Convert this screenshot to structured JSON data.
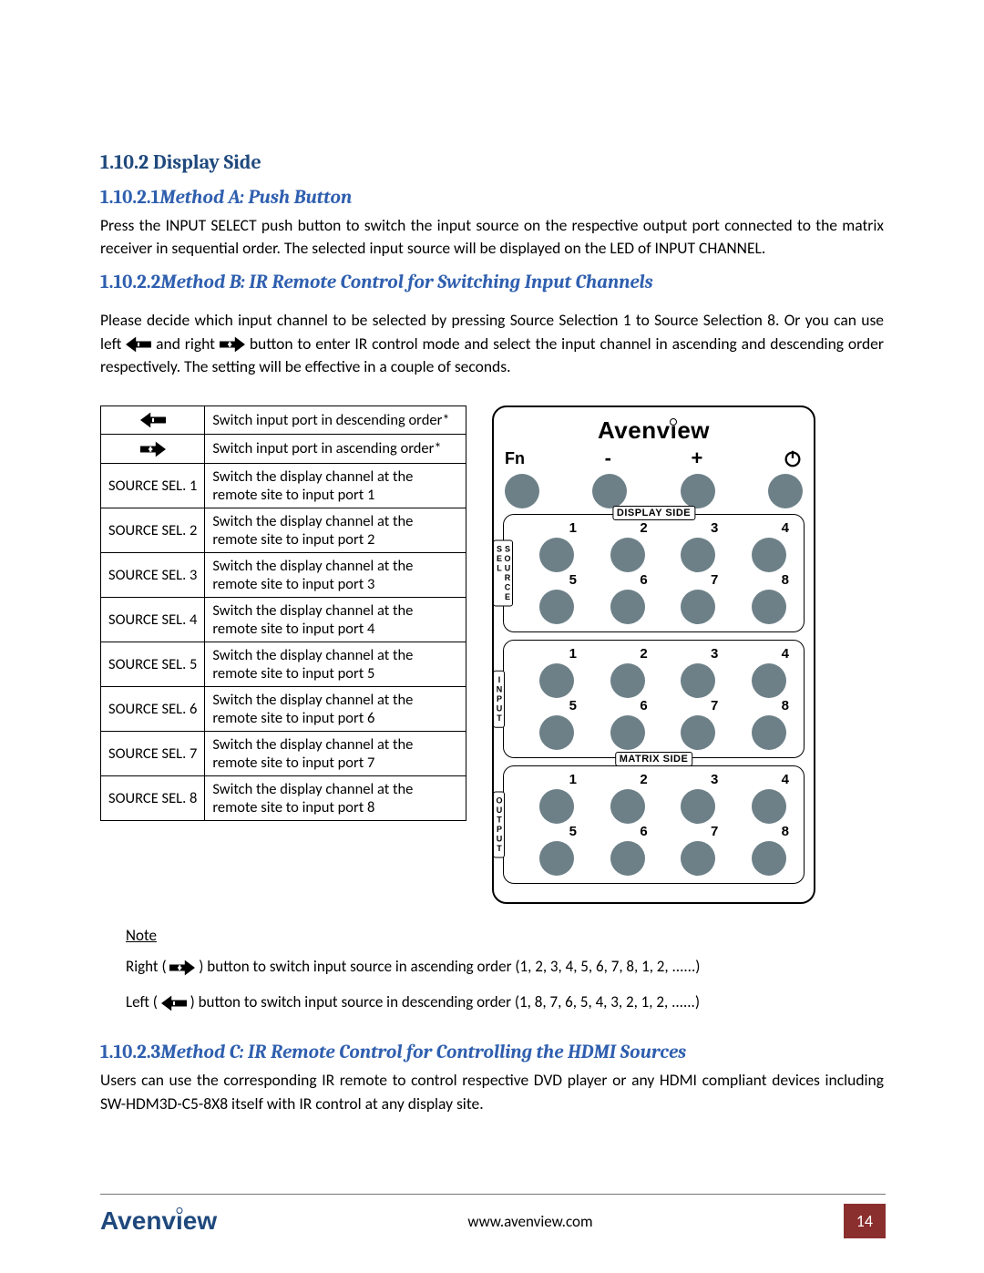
{
  "headings": {
    "h1": "1.10.2 Display Side",
    "h2a_num": "1.10.2.1",
    "h2a_txt": "Method A: Push Button",
    "h2b_num": "1.10.2.2",
    "h2b_txt": "Method B: IR Remote Control for Switching Input Channels",
    "h2c_num": "1.10.2.3",
    "h2c_txt": "Method C: IR Remote Control for Controlling the HDMI Sources"
  },
  "paragraphs": {
    "a": "Press the INPUT SELECT push button to switch the input source on the respective output port connected to the matrix receiver in sequential order. The selected input source will be displayed on the LED of INPUT CHANNEL.",
    "b_pre": "Please decide which input channel to be selected by pressing Source Selection 1 to Source Selection 8. Or you can use left ",
    "b_mid": " and right ",
    "b_post": " button to enter IR control mode and select the input channel in ascending and descending order respectively. The setting will be effective in a couple of seconds.",
    "c": "Users can use the corresponding IR remote to control respective DVD player or any HDMI compliant devices including SW-HDM3D-C5-8X8 itself with IR control at any display site."
  },
  "func_table": {
    "rows": [
      {
        "label": "__ARROW_LEFT__",
        "desc": "Switch input port in descending order*"
      },
      {
        "label": "__ARROW_RIGHT__",
        "desc": "Switch input port in ascending order*"
      },
      {
        "label": "SOURCE SEL. 1",
        "desc": "Switch the display channel at the remote site to input port 1"
      },
      {
        "label": "SOURCE SEL. 2",
        "desc": "Switch the display channel at the remote site to input port 2"
      },
      {
        "label": "SOURCE SEL. 3",
        "desc": "Switch the display channel at the remote site to input port 3"
      },
      {
        "label": "SOURCE SEL. 4",
        "desc": "Switch the display channel at the remote site to input port 4"
      },
      {
        "label": "SOURCE SEL. 5",
        "desc": "Switch the display channel at the remote site to input port 5"
      },
      {
        "label": "SOURCE SEL. 6",
        "desc": "Switch the display channel at the remote site to input port 6"
      },
      {
        "label": "SOURCE SEL. 7",
        "desc": "Switch the display channel at the remote site to input port 7"
      },
      {
        "label": "SOURCE SEL. 8",
        "desc": "Switch the display channel at the remote site to input port 8"
      }
    ]
  },
  "remote": {
    "brand": "Avenview",
    "fn": "Fn",
    "minus": "-",
    "plus": "+",
    "tags": {
      "display_side": "DISPLAY SIDE",
      "source_sel": "SOURCE SEL",
      "input": "INPUT",
      "matrix_side": "MATRIX SIDE",
      "output": "OUTPUT"
    },
    "nums_top": [
      "1",
      "2",
      "3",
      "4"
    ],
    "nums_bot": [
      "5",
      "6",
      "7",
      "8"
    ]
  },
  "notes": {
    "title": "Note",
    "right_pre": "Right (",
    "right_post": ") button to switch input source in ascending order (1, 2, 3, 4, 5, 6, 7, 8, 1, 2, ......)",
    "left_pre": "Left (",
    "left_post": " ) button to switch input source in descending order (1, 8, 7, 6, 5, 4, 3, 2, 1, 2, ......)"
  },
  "footer": {
    "logo": "Avenview",
    "url": "www.avenview.com",
    "page": "14"
  }
}
